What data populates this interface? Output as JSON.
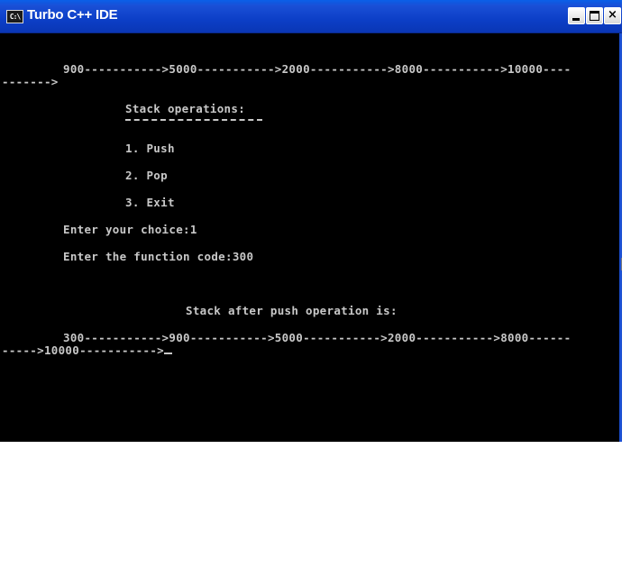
{
  "window": {
    "title": "Turbo C++ IDE",
    "icon_label": "C:\\",
    "controls": {
      "minimize": "minimize",
      "maximize": "maximize",
      "close": "×"
    }
  },
  "console": {
    "list_before_line1": "900----------->5000----------->2000----------->8000----------->10000----",
    "list_before_line2": "------->",
    "menu_title": "Stack operations:",
    "menu_items": [
      "1. Push",
      "2. Pop",
      "3. Exit"
    ],
    "choice_prompt": "Enter your choice:1",
    "code_prompt": "Enter the function code:300",
    "result_heading": "Stack after push operation is:",
    "list_after_line1": "300----------->900----------->5000----------->2000----------->8000------",
    "list_after_line2": "----->10000----------->"
  }
}
